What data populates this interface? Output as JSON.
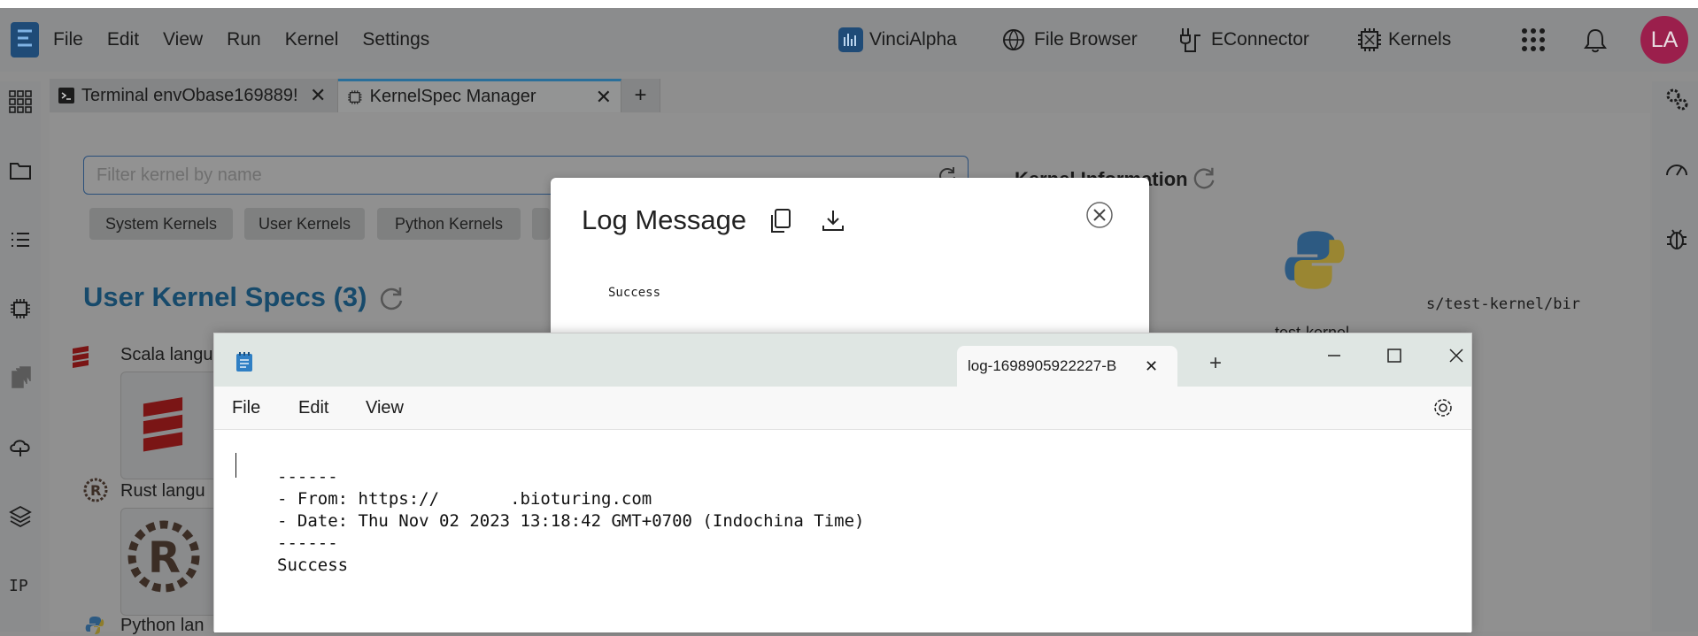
{
  "app": {
    "menu": [
      "File",
      "Edit",
      "View",
      "Run",
      "Kernel",
      "Settings"
    ],
    "tools": {
      "vinci": "VinciAlpha",
      "file_browser": "File Browser",
      "econnector": "EConnector",
      "kernels": "Kernels"
    },
    "avatar_initials": "LA"
  },
  "tabs": [
    {
      "label": "Terminal envObase169889!",
      "active": false
    },
    {
      "label": "KernelSpec Manager",
      "active": true
    }
  ],
  "kernel_manager": {
    "filter_placeholder": "Filter kernel by name",
    "chips": [
      "System Kernels",
      "User Kernels",
      "Python Kernels"
    ],
    "section_title": "User Kernel Specs (3)",
    "kernels": [
      {
        "label": "Scala langu"
      },
      {
        "label": "Rust langu"
      },
      {
        "label": "Python lan"
      }
    ],
    "kernel_info_title": "Kernel Information",
    "kernel_name_label": "test-kernel",
    "path_fragment": "s/test-kernel/bir"
  },
  "log_dialog": {
    "title": "Log Message",
    "body": "Success"
  },
  "notepad": {
    "tab_title": "log-1698905922227-B",
    "menu": [
      "File",
      "Edit",
      "View"
    ],
    "lines": [
      "------",
      "- From: https://       .bioturing.com",
      "- Date: Thu Nov 02 2023 13:18:42 GMT+0700 (Indochina Time)",
      "------",
      "Success"
    ]
  },
  "colors": {
    "accent": "#174a6b",
    "avatar_bg": "#9b1f4c",
    "overlay_bg": "#8e8e8e"
  }
}
